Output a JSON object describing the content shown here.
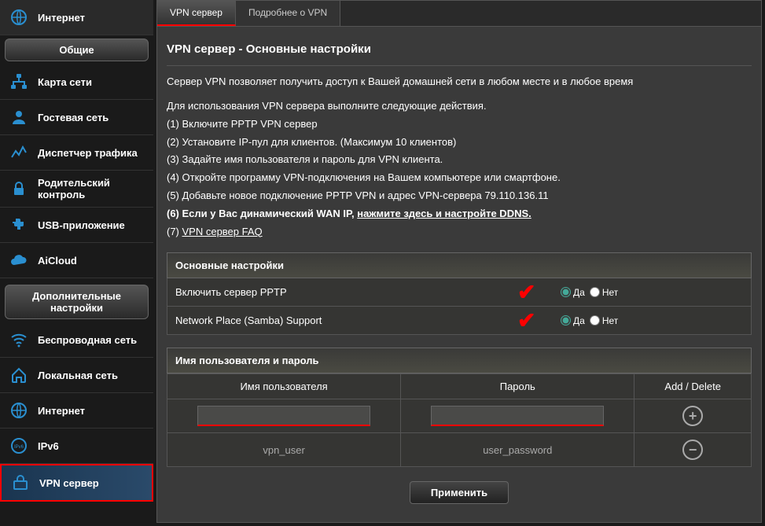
{
  "sidebar": {
    "internet_top": "Интернет",
    "section_general": "Общие",
    "items_general": [
      "Карта сети",
      "Гостевая сеть",
      "Диспетчер трафика",
      "Родительский контроль",
      "USB-приложение",
      "AiCloud"
    ],
    "section_advanced": "Дополнительные настройки",
    "items_advanced": [
      "Беспроводная сеть",
      "Локальная сеть",
      "Интернет",
      "IPv6",
      "VPN сервер"
    ]
  },
  "tabs": {
    "vpn_server": "VPN сервер",
    "vpn_about": "Подробнее о VPN"
  },
  "title": "VPN сервер - Основные настройки",
  "intro": "Сервер VPN позволяет получить доступ к Вашей домашней сети в любом месте и в любое время",
  "steps_heading": "Для использования VPN сервера выполните следующие действия.",
  "steps": [
    "(1) Включите PPTP VPN сервер",
    "(2) Установите IP-пул для клиентов. (Максимум 10 клиентов)",
    "(3) Задайте имя пользователя и пароль для VPN клиента.",
    "(4) Откройте программу VPN-подключения на Вашем компьютере или смартфоне.",
    "(5) Добавьте новое подключение PPTP VPN и адрес VPN-сервера 79.110.136.11"
  ],
  "step6_prefix": "(6) Если у Вас динамический WAN IP, ",
  "step6_link": "нажмите здесь и настройте DDNS.",
  "step7_prefix": "(7) ",
  "step7_link": "VPN сервер FAQ",
  "section_basic": "Основные настройки",
  "row_pptp": "Включить сервер PPTP",
  "row_samba": "Network Place (Samba) Support",
  "opt_yes": "Да",
  "opt_no": "Нет",
  "section_creds": "Имя пользователя и пароль",
  "col_user": "Имя пользователя",
  "col_pass": "Пароль",
  "col_action": "Add / Delete",
  "sample_user": "vpn_user",
  "sample_pass": "user_password",
  "apply": "Применить"
}
